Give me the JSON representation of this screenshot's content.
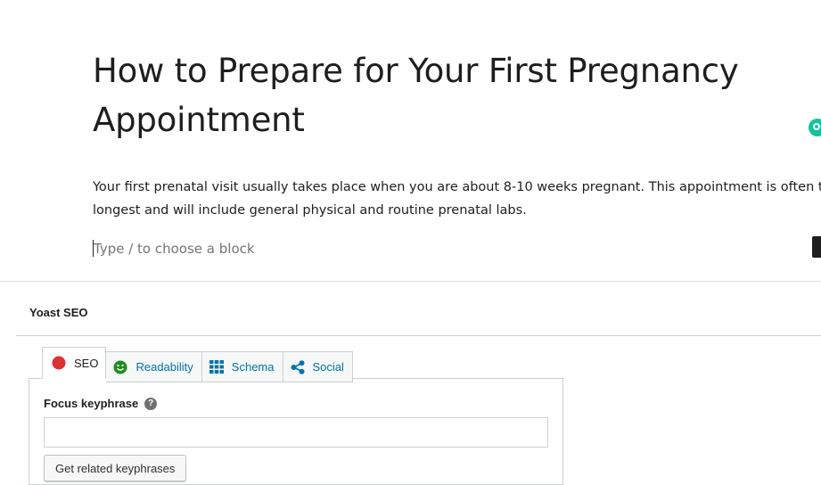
{
  "post": {
    "title": "How to Prepare for Your First Pregnancy Appointment",
    "title_line1": "How to Prepare for Your First Pregnancy",
    "title_line2": "Appointment",
    "paragraph_line1": "Your first prenatal visit usually takes place when you are about 8-10 weeks pregnant. This appointment is often the",
    "paragraph_line2": "longest and will include general physical and routine prenatal labs.",
    "block_placeholder": "Type / to choose a block"
  },
  "yoast": {
    "title": "Yoast SEO",
    "tabs": [
      {
        "label": "SEO",
        "icon": "red-dot-icon",
        "active": true
      },
      {
        "label": "Readability",
        "icon": "smiley-icon",
        "active": false
      },
      {
        "label": "Schema",
        "icon": "grid-icon",
        "active": false
      },
      {
        "label": "Social",
        "icon": "share-icon",
        "active": false
      }
    ],
    "focus_keyphrase_label": "Focus keyphrase",
    "help_glyph": "?",
    "focus_keyphrase_value": "",
    "related_button_label": "Get related keyphrases"
  },
  "colors": {
    "seo_status": "#dc3232",
    "readability_status": "#1e8c1e",
    "link": "#0073aa",
    "grammarly": "#15c39a"
  }
}
